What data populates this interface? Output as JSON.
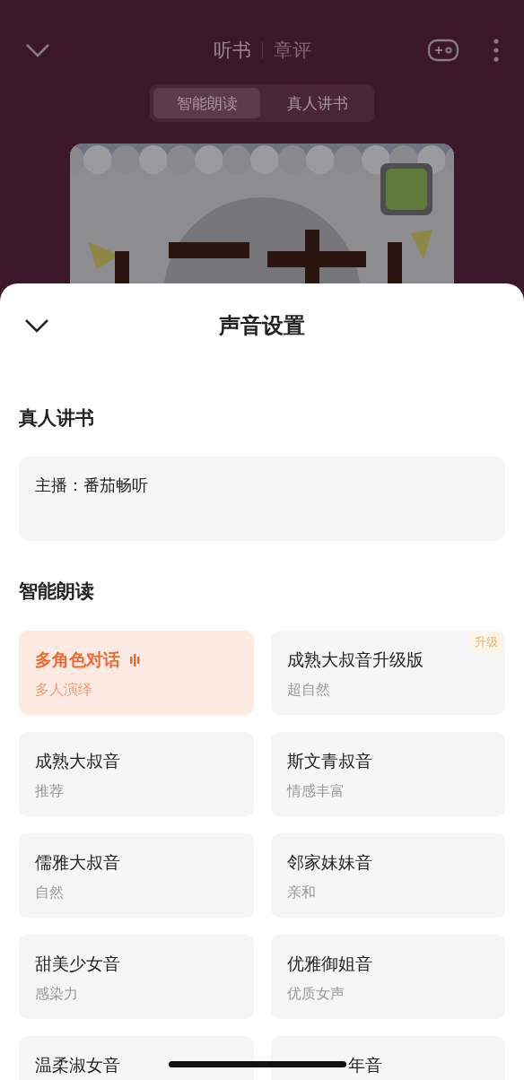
{
  "header": {
    "tabs": [
      {
        "label": "听书",
        "selected": true
      },
      {
        "label": "章评",
        "selected": false
      }
    ]
  },
  "mode_switch": [
    {
      "label": "智能朗读",
      "selected": true
    },
    {
      "label": "真人讲书",
      "selected": false
    }
  ],
  "sheet": {
    "title": "声音设置",
    "human_reading": {
      "title": "真人讲书",
      "host": "主播：番茄畅听"
    },
    "smart_reading": {
      "title": "智能朗读",
      "voice_rows": [
        [
          {
            "name": "多角色对话",
            "desc": "多人演绎",
            "selected": true
          },
          {
            "name": "成熟大叔音升级版",
            "desc": "超自然",
            "selected": false,
            "badge": "升级"
          }
        ],
        [
          {
            "name": "成熟大叔音",
            "desc": "推荐",
            "selected": false
          },
          {
            "name": "斯文青叔音",
            "desc": "情感丰富",
            "selected": false
          }
        ],
        [
          {
            "name": "儒雅大叔音",
            "desc": "自然",
            "selected": false
          },
          {
            "name": "邻家妹妹音",
            "desc": "亲和",
            "selected": false
          }
        ],
        [
          {
            "name": "甜美少女音",
            "desc": "感染力",
            "selected": false
          },
          {
            "name": "优雅御姐音",
            "desc": "优质女声",
            "selected": false
          }
        ],
        [
          {
            "name": "温柔淑女音",
            "selected": false
          },
          {
            "name": "年音",
            "selected": false,
            "covered": true
          }
        ]
      ]
    }
  }
}
